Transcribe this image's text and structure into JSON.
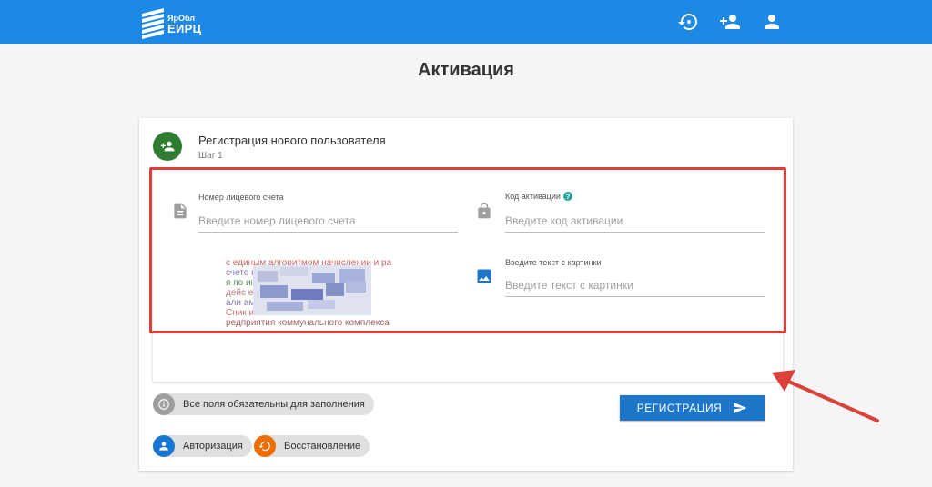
{
  "header": {
    "logo_top": "ЯрОбл",
    "logo_bottom": "ЕИРЦ",
    "icons": [
      "restore-icon",
      "add-user-icon",
      "user-icon"
    ]
  },
  "page": {
    "title": "Активация"
  },
  "step": {
    "title": "Регистрация нового пользователя",
    "subtitle": "Шаг 1"
  },
  "form": {
    "account": {
      "label": "Номер лицевого счета",
      "placeholder": "Введите номер лицевого счета"
    },
    "code": {
      "label": "Код активации",
      "help": "?",
      "placeholder": "Введите код активации"
    },
    "captcha_input": {
      "label": "Введите текст с картинки",
      "placeholder": "Введите текст с картинки"
    },
    "captcha_lines": [
      "с единым алгоритмом начислении и ра",
      "счето                                        пуг",
      "я по                                         ин с",
      "дейс                                          ентр",
      "али                                           ами",
      "Сник                                          ики",
      "редприятия коммунального комплекса"
    ],
    "submit_label": "РЕГИСТРАЦИЯ"
  },
  "notices": {
    "required": "Все поля обязательны для заполнения"
  },
  "links": {
    "auth": "Авторизация",
    "restore": "Восстановление"
  },
  "colors": {
    "brand": "#1e88e5",
    "step_badge": "#2e7d32",
    "button": "#1e76c8",
    "auth_chip": "#1976d2",
    "restore_chip": "#ef6c00",
    "annotation": "#d9413a"
  }
}
